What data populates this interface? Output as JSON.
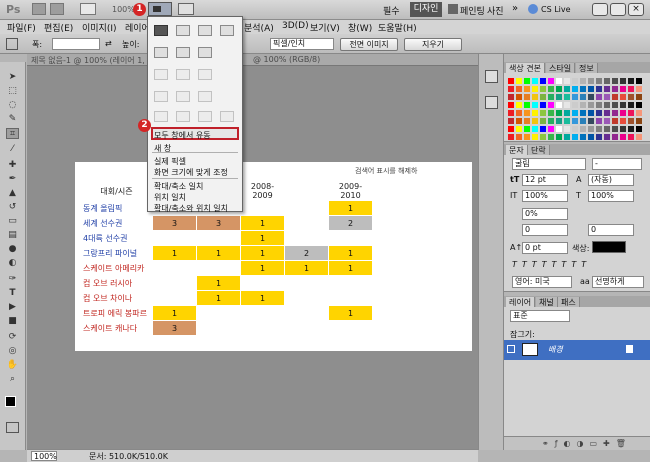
{
  "app": {
    "logo": "Ps",
    "zoom_value": "100%",
    "workspaces": [
      "필수",
      "디자인",
      "페인팅",
      "사진"
    ],
    "more": "»",
    "cs_live": "CS Live",
    "window_controls": [
      "minimize",
      "restore",
      "close"
    ]
  },
  "menu": {
    "items": [
      "파일(F)",
      "편집(E)",
      "이미지(I)",
      "레이어",
      "분석(A)",
      "3D(D)",
      "보기(V)",
      "창(W)",
      "도움말(H)"
    ]
  },
  "options": {
    "width_label": "폭:",
    "height_label": "높이:",
    "resolution_unit": "픽셀/인치",
    "front_image_button": "전면 이미지",
    "clear_button": "지우기"
  },
  "document": {
    "tab_title": "제목 없음-1 @ 100% (레이어 1, RGB/8)",
    "tab_title_2": "@ 100% (RGB/8)",
    "search_text": "검색어 표시를 해제하",
    "status_zoom": "100%",
    "status_doc": "문서: 510.0K/510.0K"
  },
  "table": {
    "header_first": "대회/시즌",
    "seasons": [
      "2008-2009",
      "2009-2010"
    ],
    "rows": [
      {
        "name": "동계 올림픽",
        "color": "blue",
        "cells": [
          "",
          "",
          "",
          "",
          "1"
        ]
      },
      {
        "name": "세계 선수권",
        "color": "blue",
        "cells": [
          "3",
          "3",
          "1",
          "",
          "2"
        ]
      },
      {
        "name": "4대륙 선수권",
        "color": "blue",
        "cells": [
          "",
          "",
          "1",
          "",
          ""
        ]
      },
      {
        "name": "그랑프리 파이널",
        "color": "blue",
        "cells": [
          "1",
          "1",
          "1",
          "2",
          "1"
        ]
      },
      {
        "name": "스케이트 아메리카",
        "color": "red",
        "cells": [
          "",
          "",
          "1",
          "1",
          "1"
        ]
      },
      {
        "name": "컵 오브 러시아",
        "color": "red",
        "cells": [
          "",
          "1",
          "",
          "",
          ""
        ]
      },
      {
        "name": "컵 오브 차이나",
        "color": "red",
        "cells": [
          "",
          "1",
          "1",
          "",
          ""
        ]
      },
      {
        "name": "트로피 에릭 봉파르",
        "color": "red",
        "cells": [
          "1",
          "",
          "",
          "",
          "1"
        ]
      },
      {
        "name": "스케이트 캐나다",
        "color": "red",
        "cells": [
          "3",
          "",
          "",
          "",
          ""
        ]
      }
    ]
  },
  "arrange_menu": {
    "highlighted_item": "모두 창에서 유동",
    "items_group1": [
      "새 창"
    ],
    "items_group2": [
      "실제 픽셀",
      "화면 크기에 맞게 조정"
    ],
    "items_group3": [
      "확대/축소 일치",
      "위치 일치",
      "확대/축소와 위치 일치"
    ],
    "badges": [
      "1",
      "2"
    ]
  },
  "panels": {
    "swatches": {
      "tabs": [
        "색상 견본",
        "스타일",
        "정보"
      ]
    },
    "character": {
      "tabs": [
        "문자",
        "단락"
      ],
      "font_family": "굴림",
      "font_style": "-",
      "font_size": "12 pt",
      "leading": "(자동)",
      "vertical_scale": "100%",
      "horizontal_scale": "100%",
      "tracking_pct": "0%",
      "kerning": "0",
      "tracking": "0",
      "baseline": "0 pt",
      "color_label": "색상:",
      "language": "영어: 미국",
      "antialias": "선명하게"
    },
    "layers": {
      "tabs": [
        "레이어",
        "채널",
        "패스"
      ],
      "blend_mode": "표준",
      "lock_label": "잠그기:",
      "layer_name": "배경"
    }
  },
  "colors": {
    "accent_red": "#c0202a",
    "yellow_cell": "#ffd400",
    "orange_cell": "#d59565",
    "gray_cell": "#bdbdbd"
  }
}
